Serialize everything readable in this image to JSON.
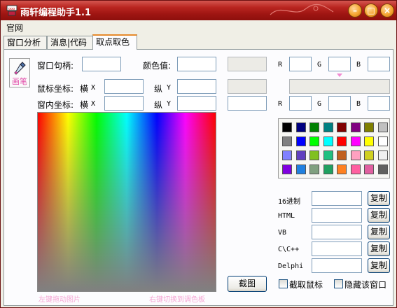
{
  "window": {
    "title": "雨轩编程助手1.1"
  },
  "menu": {
    "items": [
      "官网"
    ]
  },
  "tabs": [
    "窗口分析",
    "消息|代码",
    "取点取色"
  ],
  "tool": {
    "pen_label": "画笔"
  },
  "labels": {
    "window_handle": "窗口句柄:",
    "color_value": "颜色值:",
    "mouse_coord": "鼠标坐标:",
    "in_window_coord": "窗内坐标:",
    "horizontal": "横",
    "vertical": "纵",
    "x": "X",
    "y": "Y",
    "r": "R",
    "g": "G",
    "b": "B"
  },
  "fields": {
    "window_handle": "",
    "color_value": "",
    "color_preview": "",
    "r1": "",
    "g1": "",
    "b1": "",
    "mouse_x": "",
    "mouse_y": "",
    "win_x": "",
    "win_y": "",
    "color_preview2": "",
    "color_preview3": "",
    "r2": "",
    "g2": "",
    "b2": ""
  },
  "hints": {
    "left": "左键拖动图片",
    "right": "右键切换到调色板"
  },
  "palette": {
    "colors": [
      "#000000",
      "#000080",
      "#008000",
      "#008080",
      "#800000",
      "#800080",
      "#808000",
      "#c0c0c0",
      "#808080",
      "#0000ff",
      "#00ff00",
      "#00ffff",
      "#ff0000",
      "#ff00ff",
      "#ffff00",
      "#ffffff",
      "#8080ff",
      "#6040c0",
      "#80c020",
      "#20c080",
      "#c06020",
      "#ffa0c0",
      "#d0d020",
      "#f0f0f0",
      "#8000e0",
      "#2080e0",
      "#80a080",
      "#20a060",
      "#ff8020",
      "#ff60a0",
      "#e060a0",
      "#606060"
    ]
  },
  "formats": [
    {
      "label": "16进制",
      "value": "",
      "copy": "复制"
    },
    {
      "label": "HTML",
      "value": "",
      "copy": "复制"
    },
    {
      "label": "VB",
      "value": "",
      "copy": "复制"
    },
    {
      "label": "C\\C++",
      "value": "",
      "copy": "复制"
    },
    {
      "label": "Delphi",
      "value": "",
      "copy": "复制"
    }
  ],
  "screenshot_button": "截图",
  "checkboxes": {
    "capture_mouse": "截取鼠标",
    "hide_window": "隐藏该窗口"
  },
  "colors": {
    "titlebar": "#b8241f",
    "accent_pink": "#e14aa8",
    "tab_highlight": "#e68b2c"
  }
}
